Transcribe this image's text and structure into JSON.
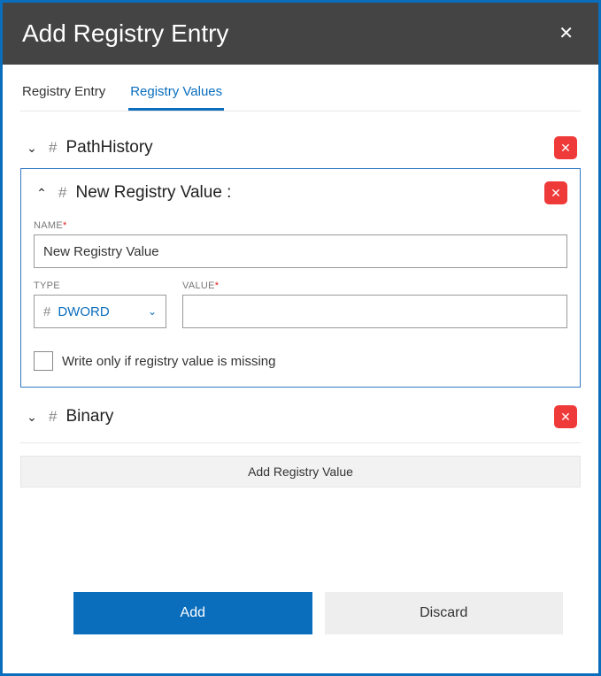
{
  "dialog": {
    "title": "Add Registry Entry"
  },
  "tabs": {
    "entry": "Registry Entry",
    "values": "Registry Values"
  },
  "items": {
    "path_history": {
      "title": "PathHistory"
    },
    "new_value": {
      "title": "New Registry Value :",
      "name_label": "NAME",
      "name_value": "New Registry Value",
      "type_label": "TYPE",
      "type_value": "DWORD",
      "value_label": "VALUE",
      "value_value": "",
      "write_if_missing": "Write only if registry value is missing"
    },
    "binary": {
      "title": "Binary"
    }
  },
  "buttons": {
    "add_value": "Add Registry Value",
    "add": "Add",
    "discard": "Discard"
  }
}
